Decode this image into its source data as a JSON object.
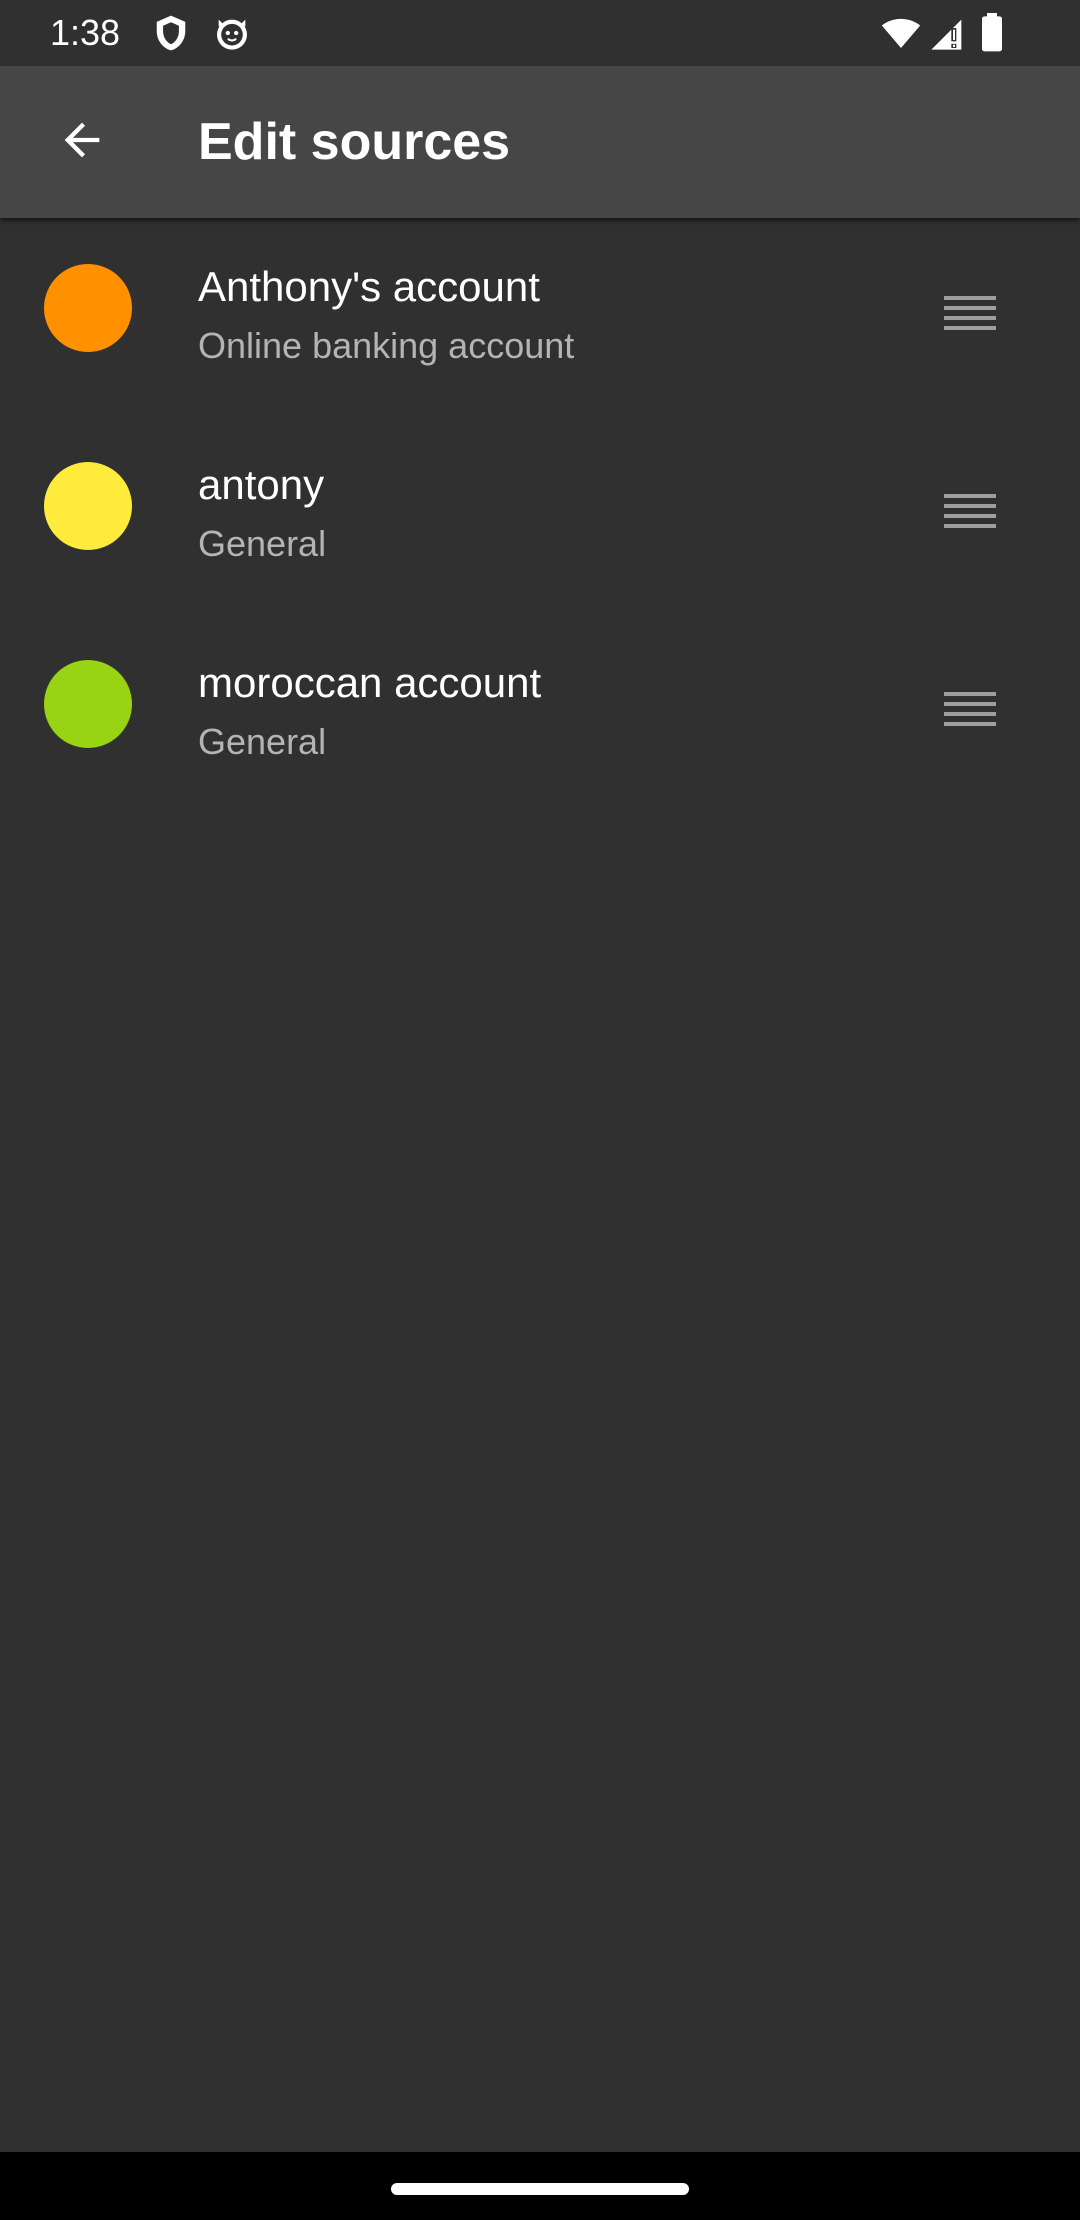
{
  "status_bar": {
    "time": "1:38",
    "icons": [
      "shield-icon",
      "cat-icon",
      "wifi-icon",
      "signal-icon",
      "battery-icon"
    ]
  },
  "app_bar": {
    "title": "Edit sources",
    "back_icon": "arrow-back-icon"
  },
  "sources": [
    {
      "name": "Anthony's account",
      "type": "Online banking account",
      "color": "#FF9100"
    },
    {
      "name": "antony",
      "type": "General",
      "color": "#FFEB3B"
    },
    {
      "name": "moroccan account",
      "type": "General",
      "color": "#99D414"
    }
  ],
  "colors": {
    "background": "#303030",
    "app_bar": "#464646",
    "primary_text": "#FFFFFF",
    "secondary_text": "#B4B4B4",
    "handle": "#9E9E9E"
  }
}
